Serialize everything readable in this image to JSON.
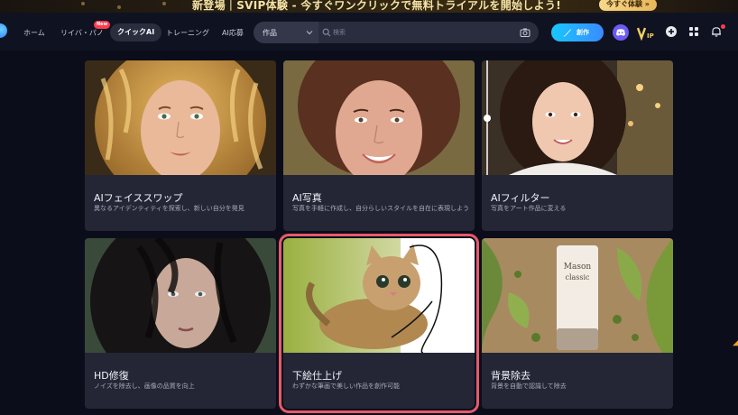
{
  "banner": {
    "text": "新登場｜SVIP体験 - 今すぐワンクリックで無料トライアルを開始しよう!",
    "button": "今すぐ体験 »"
  },
  "nav": {
    "items": [
      {
        "label": "ホーム",
        "active": false
      },
      {
        "label": "リイバ・パノ",
        "active": false
      },
      {
        "label": "クイックAI",
        "active": true
      },
      {
        "label": "トレーニング",
        "active": false
      },
      {
        "label": "AI応募",
        "active": false
      }
    ],
    "new_badge": "New"
  },
  "search": {
    "category": "作品",
    "placeholder": "検索"
  },
  "header": {
    "create_label": "創作"
  },
  "cards": [
    {
      "title": "AIフェイススワップ",
      "desc": "異なるアイデンティティを探索し、新しい自分を発見"
    },
    {
      "title": "AI写真",
      "desc": "写真を手軽に作成し、自分らしいスタイルを自在に表現しよう"
    },
    {
      "title": "AIフィルター",
      "desc": "写真をアート作品に変える"
    },
    {
      "title": "HD修復",
      "desc": "ノイズを除去し、画像の品質を向上"
    },
    {
      "title": "下絵仕上げ",
      "desc": "わずかな筆画で美しい作品を創作可能"
    },
    {
      "title": "背景除去",
      "desc": "背景を自動で認識して除去"
    }
  ],
  "product_label": {
    "line1": "Mason",
    "line2": "classic"
  },
  "colors": {
    "background": "#0b0e1a",
    "card": "#242636",
    "accent": "#19c6ff",
    "selection": "#e85a6a"
  }
}
